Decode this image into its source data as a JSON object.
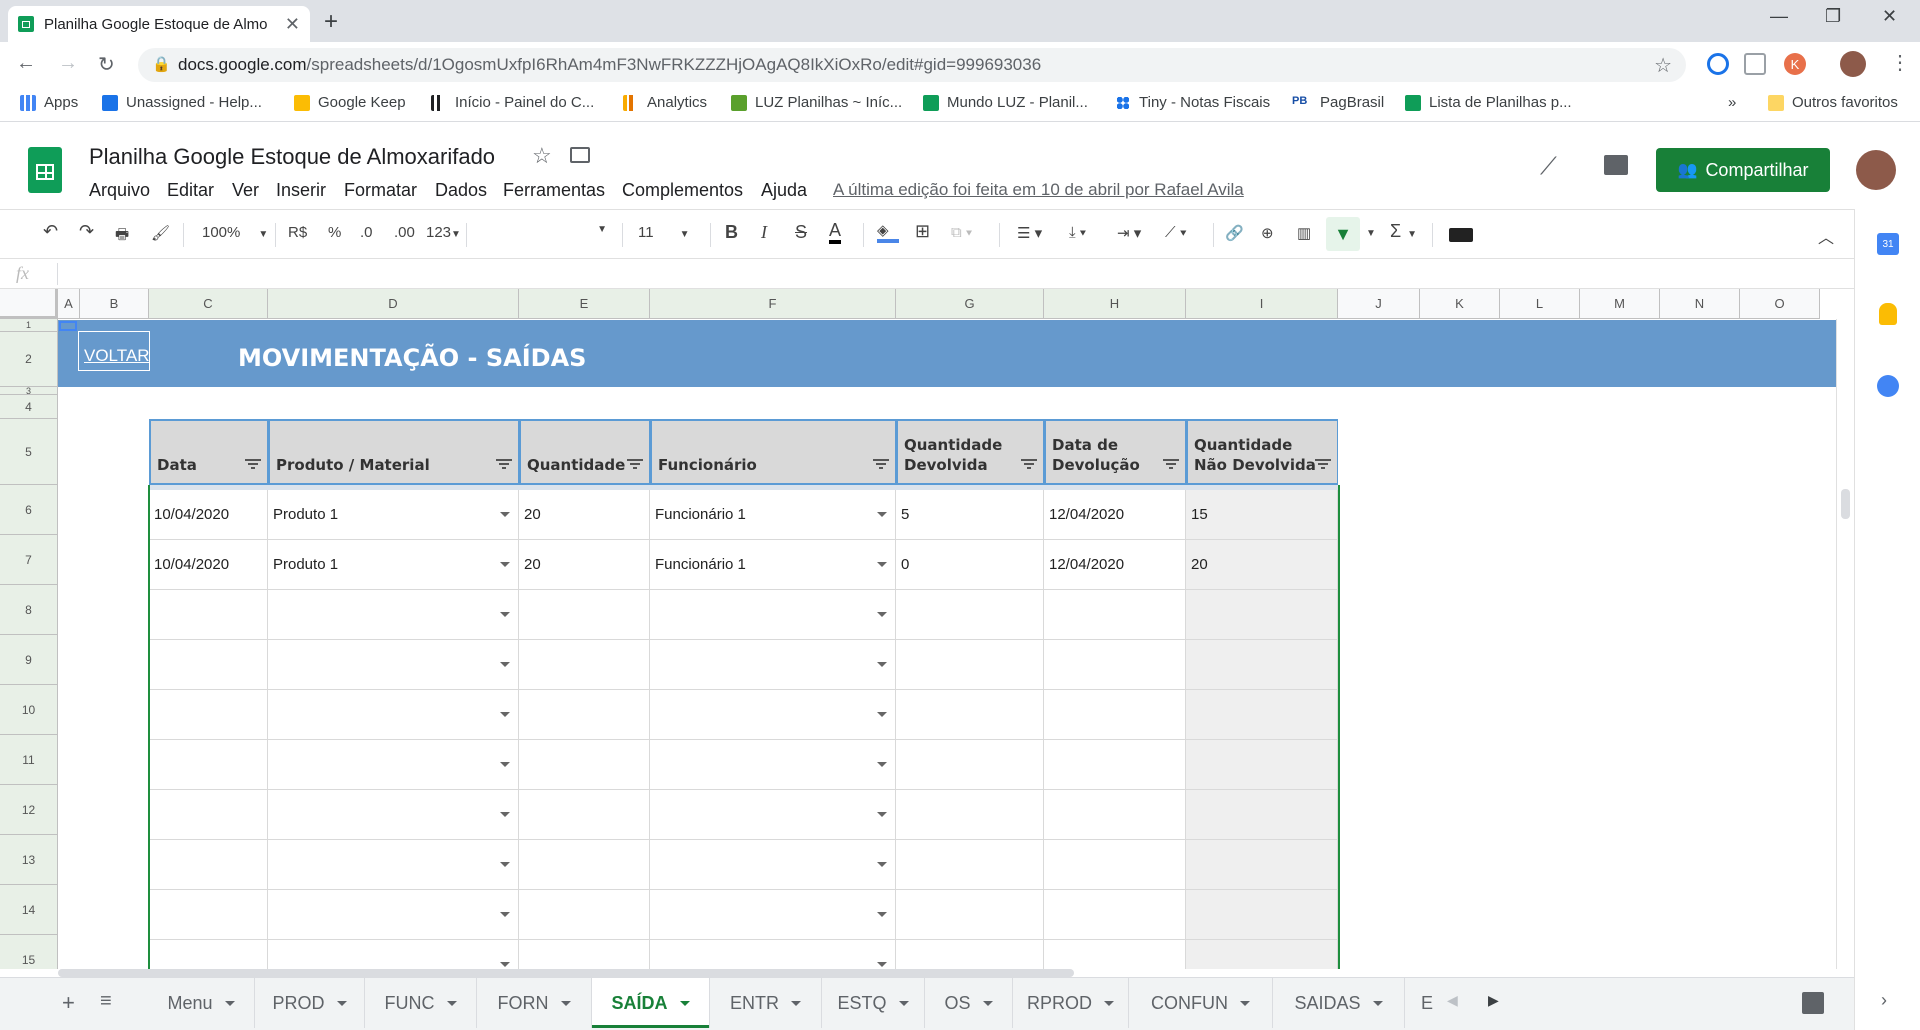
{
  "browser": {
    "tab_title": "Planilha Google Estoque de Almo",
    "url_domain": "docs.google.com",
    "url_path": "/spreadsheets/d/1OgosmUxfpI6RhAm4mF3NwFRKZZZHjOAgAQ8IkXiOxRo/edit#gid=999693036",
    "bookmarks": [
      {
        "label": "Apps",
        "color": "#4285f4"
      },
      {
        "label": "Unassigned - Help...",
        "color": "#1a73e8"
      },
      {
        "label": "Google Keep",
        "color": "#fbbc04"
      },
      {
        "label": "Início - Painel do C...",
        "color": "#202124"
      },
      {
        "label": "Analytics",
        "color": "#f9ab00"
      },
      {
        "label": "LUZ Planilhas ~ Iníc...",
        "color": "#5aa02c"
      },
      {
        "label": "Mundo LUZ - Planil...",
        "color": "#0f9d58"
      },
      {
        "label": "Tiny - Notas Fiscais",
        "color": "#1a73e8"
      },
      {
        "label": "PagBrasil",
        "color": "#174ea6"
      },
      {
        "label": "Lista de Planilhas p...",
        "color": "#0f9d58"
      }
    ],
    "more": "»",
    "other_bookmarks": "Outros favoritos"
  },
  "doc": {
    "title": "Planilha Google Estoque de Almoxarifado",
    "menus": [
      "Arquivo",
      "Editar",
      "Ver",
      "Inserir",
      "Formatar",
      "Dados",
      "Ferramentas",
      "Complementos",
      "Ajuda"
    ],
    "last_edit": "A última edição foi feita em 10 de abril por Rafael Avila",
    "share": "Compartilhar"
  },
  "toolbar": {
    "zoom": "100%",
    "currency": "R$",
    "percent": "%",
    "dec_less": ".0",
    "dec_more": ".00",
    "format": "123",
    "font_size": "11",
    "bold": "B",
    "italic": "I",
    "strike": "S",
    "text_color": "A",
    "sum": "Σ"
  },
  "formula_bar": {
    "fx": "fx",
    "value": ""
  },
  "columns": [
    "A",
    "B",
    "C",
    "D",
    "E",
    "F",
    "G",
    "H",
    "I",
    "J",
    "K",
    "L",
    "M",
    "N",
    "O"
  ],
  "rows": [
    "1",
    "2",
    "3",
    "4",
    "5",
    "6",
    "7",
    "8",
    "9",
    "10",
    "11",
    "12",
    "13",
    "14",
    "15"
  ],
  "banner": {
    "voltar": "VOLTAR",
    "title": "MOVIMENTAÇÃO - SAÍDAS"
  },
  "table": {
    "headers": [
      [
        "Data"
      ],
      [
        "Produto / Material"
      ],
      [
        "Quantidade"
      ],
      [
        "Funcionário"
      ],
      [
        "Quantidade",
        "Devolvida"
      ],
      [
        "Data de",
        "Devolução"
      ],
      [
        "Quantidade",
        "Não Devolvida"
      ]
    ],
    "rows": [
      [
        "10/04/2020",
        "Produto 1",
        "20",
        "Funcionário 1",
        "5",
        "12/04/2020",
        "15"
      ],
      [
        "10/04/2020",
        "Produto 1",
        "20",
        "Funcionário 1",
        "0",
        "12/04/2020",
        "20"
      ],
      [
        "",
        "",
        "",
        "",
        "",
        "",
        ""
      ],
      [
        "",
        "",
        "",
        "",
        "",
        "",
        ""
      ],
      [
        "",
        "",
        "",
        "",
        "",
        "",
        ""
      ],
      [
        "",
        "",
        "",
        "",
        "",
        "",
        ""
      ],
      [
        "",
        "",
        "",
        "",
        "",
        "",
        ""
      ],
      [
        "",
        "",
        "",
        "",
        "",
        "",
        ""
      ],
      [
        "",
        "",
        "",
        "",
        "",
        "",
        ""
      ],
      [
        "",
        "",
        "",
        "",
        "",
        "",
        ""
      ]
    ]
  },
  "sheets": [
    "Menu",
    "PROD",
    "FUNC",
    "FORN",
    "SAÍDA",
    "ENTR",
    "ESTQ",
    "OS",
    "RPROD",
    "CONFUN",
    "SAIDAS",
    "E"
  ],
  "active_sheet": "SAÍDA",
  "colors": {
    "banner": "#6699cc",
    "header_border": "#5b9bd5",
    "share": "#188038",
    "sheets_green": "#0f9d58"
  }
}
